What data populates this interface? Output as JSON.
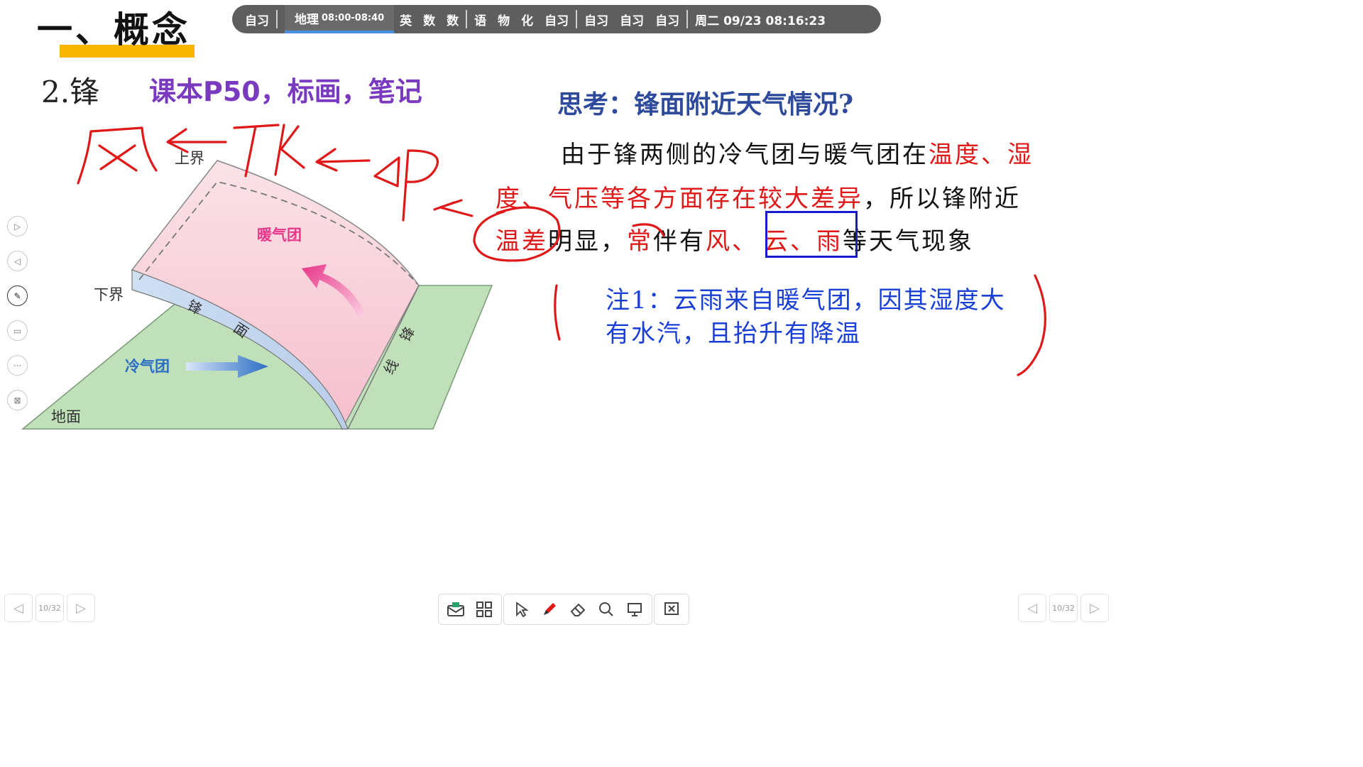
{
  "header": {
    "section_title": "一、概念",
    "sub_number": "2.锋",
    "sub_note": "课本P50，标画，笔记"
  },
  "schedule": {
    "slots": [
      "自习",
      "地理",
      "英",
      "数",
      "数",
      "语",
      "物",
      "化",
      "自习",
      "自习",
      "自习",
      "自习"
    ],
    "current_time": "08:00-08:40",
    "datetime": "周二 09/23  08:16:23",
    "accent_color": "#4a90e2"
  },
  "diagram": {
    "labels": {
      "upper": "上界",
      "lower": "下界",
      "warm": "暖气团",
      "cold": "冷气团",
      "front_surface": [
        "锋",
        "面"
      ],
      "front_line": [
        "锋",
        "线"
      ],
      "ground": "地面"
    },
    "colors": {
      "ground": "#bfe0b8",
      "warm": "#f9d3dc",
      "warm_arrow": "#e8368a",
      "cold_arrow": "#2b6cc4"
    }
  },
  "content": {
    "question": "思考：锋面附近天气情况?",
    "line1_black": "由于锋两侧的冷气团与暖气团在",
    "line1_red": "温度、湿",
    "line2_red": "度、气压等各方面存在较大差异",
    "line2_black": "，所以锋附近",
    "line3_red1": "温差",
    "line3_black1": "明显，",
    "line3_red2": "常",
    "line3_black2": "伴有",
    "line3_red3": "风、",
    "line3_red4": "云、雨",
    "line3_black3": "等天气现象",
    "note_line1": "注1：云雨来自暖气团，因其湿度大",
    "note_line2": "有水汽，且抬升有降温",
    "handwriting_color": "#e01818"
  },
  "pager": {
    "left": "10/32",
    "right": "10/32"
  },
  "sidebar": {
    "icons": [
      "next-page-icon",
      "prev-page-icon",
      "pen-settings-icon",
      "screen-icon",
      "more-icon",
      "exit-screen-icon"
    ]
  },
  "toolbar": {
    "icons": [
      "mail-icon",
      "apps-grid-icon",
      "select-pointer-icon",
      "pen-icon",
      "eraser-icon",
      "magnify-icon",
      "whiteboard-icon",
      "exit-icon"
    ]
  }
}
